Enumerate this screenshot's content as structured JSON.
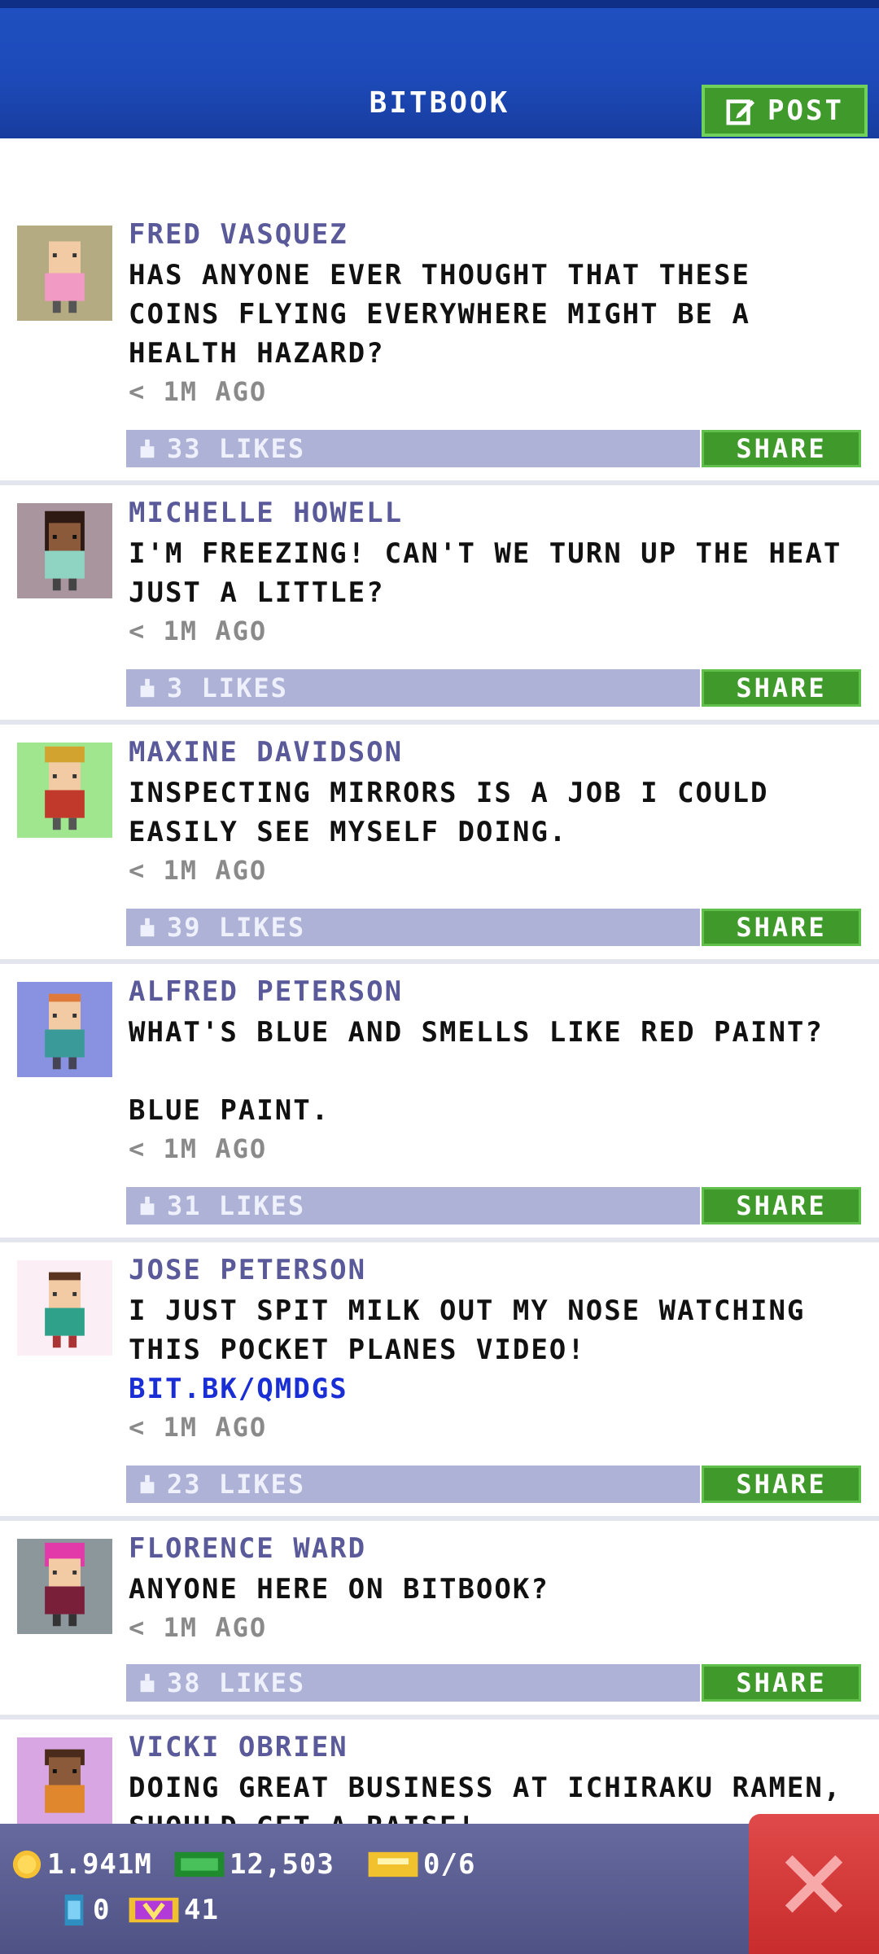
{
  "header": {
    "title": "BITBOOK",
    "post_label": "POST"
  },
  "posts": [
    {
      "author": "FRED VASQUEZ",
      "text": "HAS ANYONE EVER THOUGHT THAT THESE\nCOINS FLYING EVERYWHERE MIGHT BE A\nHEALTH HAZARD?",
      "link": "",
      "time": "< 1M AGO",
      "likes": "33 LIKES",
      "share": "SHARE",
      "avatar_bg": "#b4ab82"
    },
    {
      "author": "MICHELLE HOWELL",
      "text": "I'M FREEZING! CAN'T WE TURN UP THE HEAT\nJUST A LITTLE?",
      "link": "",
      "time": "< 1M AGO",
      "likes": "3 LIKES",
      "share": "SHARE",
      "avatar_bg": "#a8959e"
    },
    {
      "author": "MAXINE DAVIDSON",
      "text": "INSPECTING MIRRORS IS A JOB I COULD\nEASILY SEE MYSELF DOING.",
      "link": "",
      "time": "< 1M AGO",
      "likes": "39 LIKES",
      "share": "SHARE",
      "avatar_bg": "#9fe68f"
    },
    {
      "author": "ALFRED PETERSON",
      "text": "WHAT'S BLUE AND SMELLS LIKE RED PAINT?\n\nBLUE PAINT.",
      "link": "",
      "time": "< 1M AGO",
      "likes": "31 LIKES",
      "share": "SHARE",
      "avatar_bg": "#8892e0"
    },
    {
      "author": "JOSE PETERSON",
      "text": "I JUST SPIT MILK OUT MY NOSE WATCHING\nTHIS POCKET PLANES VIDEO!",
      "link": "BIT.BK/QMDGS",
      "time": "< 1M AGO",
      "likes": "23 LIKES",
      "share": "SHARE",
      "avatar_bg": "#fbeef4"
    },
    {
      "author": "FLORENCE WARD",
      "text": "ANYONE HERE ON BITBOOK?",
      "link": "",
      "time": "< 1M AGO",
      "likes": "38 LIKES",
      "share": "SHARE",
      "avatar_bg": "#8c979c"
    },
    {
      "author": "VICKI OBRIEN",
      "text": "DOING GREAT BUSINESS AT ICHIRAKU RAMEN,\nSHOULD GET A RAISE!",
      "link": "",
      "time": "",
      "likes": "",
      "share": "",
      "avatar_bg": "#d8a6e2"
    }
  ],
  "stats": {
    "coins": "1.941M",
    "cash": "12,503",
    "tickets": "0/6",
    "bux": "0",
    "vip": "41"
  },
  "colors": {
    "header_blue": "#1d4ab8",
    "share_green": "#3f9a2b",
    "like_bar": "#aeb2d6",
    "close_red": "#d23a3a"
  },
  "icons": [
    "edit-icon",
    "like-icon",
    "coin-icon",
    "cash-icon",
    "ticket-icon",
    "bux-icon",
    "vip-icon",
    "close-icon"
  ]
}
